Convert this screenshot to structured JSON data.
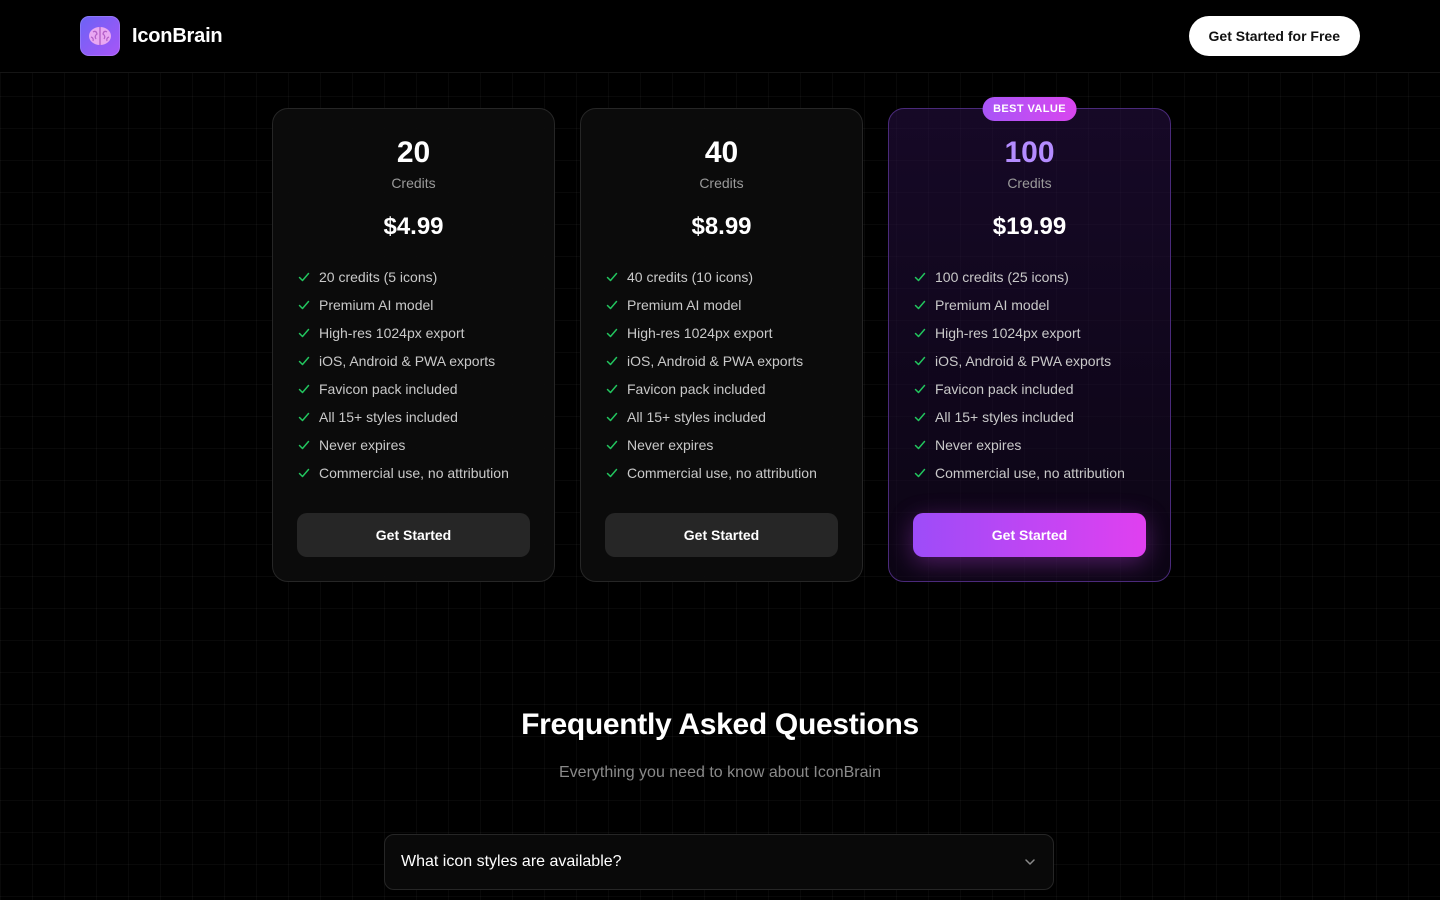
{
  "header": {
    "brand": "IconBrain",
    "cta_label": "Get Started for Free"
  },
  "plans": [
    {
      "credits": "20",
      "credits_label": "Credits",
      "price": "$4.99",
      "featured": false,
      "badge": "",
      "features": [
        "20 credits (5 icons)",
        "Premium AI model",
        "High-res 1024px export",
        "iOS, Android & PWA exports",
        "Favicon pack included",
        "All 15+ styles included",
        "Never expires",
        "Commercial use, no attribution"
      ],
      "button_label": "Get Started"
    },
    {
      "credits": "40",
      "credits_label": "Credits",
      "price": "$8.99",
      "featured": false,
      "badge": "",
      "features": [
        "40 credits (10 icons)",
        "Premium AI model",
        "High-res 1024px export",
        "iOS, Android & PWA exports",
        "Favicon pack included",
        "All 15+ styles included",
        "Never expires",
        "Commercial use, no attribution"
      ],
      "button_label": "Get Started"
    },
    {
      "credits": "100",
      "credits_label": "Credits",
      "price": "$19.99",
      "featured": true,
      "badge": "BEST VALUE",
      "features": [
        "100 credits (25 icons)",
        "Premium AI model",
        "High-res 1024px export",
        "iOS, Android & PWA exports",
        "Favicon pack included",
        "All 15+ styles included",
        "Never expires",
        "Commercial use, no attribution"
      ],
      "button_label": "Get Started"
    }
  ],
  "faq": {
    "title": "Frequently Asked Questions",
    "subtitle": "Everything you need to know about IconBrain",
    "items": [
      {
        "question": "What icon styles are available?"
      }
    ]
  },
  "icons": {
    "logo": "brain-icon",
    "feature_check": "check-icon",
    "faq_toggle": "chevron-down-icon"
  },
  "colors": {
    "background": "#000000",
    "accent_purple": "#a855f7",
    "accent_pink": "#d946ef",
    "check_green": "#22c55e",
    "featured_number": "#b48cff"
  }
}
